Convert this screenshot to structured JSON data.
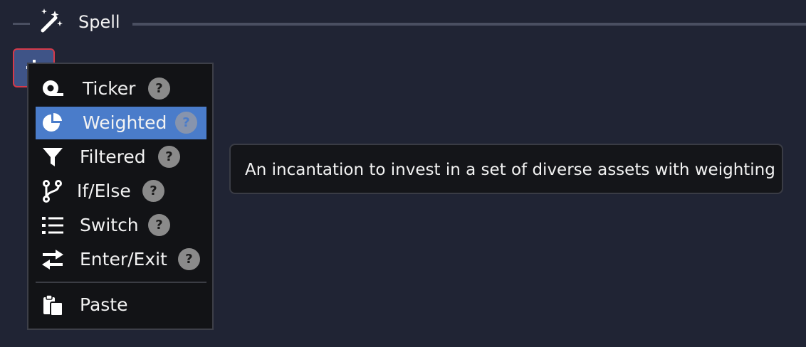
{
  "section": {
    "title": "Spell",
    "icon": "magic-wand-sparkles-icon"
  },
  "add_button": {
    "icon": "plus-icon"
  },
  "menu": {
    "items": [
      {
        "label": "Ticker",
        "icon": "ticker-tape-icon",
        "help": "?",
        "active": false
      },
      {
        "label": "Weighted",
        "icon": "pie-chart-icon",
        "help": "?",
        "active": true
      },
      {
        "label": "Filtered",
        "icon": "filter-funnel-icon",
        "help": "?",
        "active": false
      },
      {
        "label": "If/Else",
        "icon": "code-branch-icon",
        "help": "?",
        "active": false
      },
      {
        "label": "Switch",
        "icon": "list-icon",
        "help": "?",
        "active": false
      },
      {
        "label": "Enter/Exit",
        "icon": "arrows-left-right-icon",
        "help": "?",
        "active": false
      }
    ],
    "paste": {
      "label": "Paste",
      "icon": "paste-clipboard-icon"
    }
  },
  "tooltip": {
    "text": "An incantation to invest in a set of diverse assets with weighting"
  },
  "colors": {
    "background": "#202434",
    "menu_background": "#121316",
    "active_item": "#4a7cca",
    "add_button_fill": "#3f5487",
    "add_button_border": "#d53a4a",
    "help_badge": "#8a8a8a"
  }
}
